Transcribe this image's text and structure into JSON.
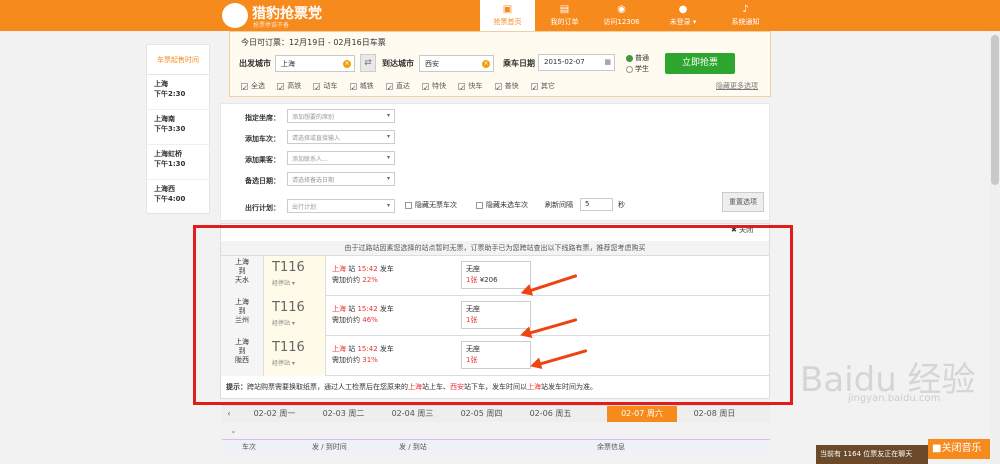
{
  "app": {
    "logo_title": "猎豹抢票党",
    "logo_sub": "抢票停谁不备"
  },
  "nav": [
    {
      "label": "抢票首页",
      "icon": "bus-icon"
    },
    {
      "label": "我的订单",
      "icon": "document-icon"
    },
    {
      "label": "访问12306",
      "icon": "globe-icon"
    },
    {
      "label": "未登录 ▾",
      "icon": "user-icon"
    },
    {
      "label": "系统通知",
      "icon": "bell-icon"
    }
  ],
  "booking": {
    "info": "今日可订票：12月19日 - 02月16日车票",
    "from_label": "出发城市",
    "from_value": "上海",
    "to_label": "到达城市",
    "to_value": "西安",
    "date_label": "乘车日期",
    "date_value": "2015-02-07",
    "radio_normal": "普通",
    "radio_student": "学生",
    "grab_button": "立即抢票",
    "types": [
      "全选",
      "高铁",
      "动车",
      "城铁",
      "直达",
      "特快",
      "快车",
      "普快",
      "其它"
    ],
    "more_options": "隐藏更多选项"
  },
  "sidebar": {
    "header": "车票起售时间",
    "items": [
      {
        "station": "上海",
        "time": "下午2:30"
      },
      {
        "station": "上海南",
        "time": "下午3:30"
      },
      {
        "station": "上海虹桥",
        "time": "下午1:30"
      },
      {
        "station": "上海西",
        "time": "下午4:00"
      }
    ]
  },
  "options": {
    "seat_label": "指定坐席：",
    "seat_ph": "添加想要的席别",
    "train_label": "添加车次：",
    "train_ph": "请选择或直接输入",
    "passenger_label": "添加乘客：",
    "passenger_ph": "添加联系人...",
    "backup_label": "备选日期：",
    "backup_ph": "请选择备选日期",
    "plan_label": "出行计划：",
    "plan_ph": "出行计划",
    "hide_no_ticket": "隐藏无票车次",
    "hide_unselected": "隐藏未选车次",
    "refresh_label": "刷新间隔",
    "refresh_value": "5",
    "refresh_unit": "秒",
    "reset_button": "重置选项"
  },
  "popup": {
    "close_label": "关闭",
    "note": "由于过路站因素您选择的站点暂时无票，订票助手已为您跨站查出以下线路有票，推荐您考虑购买",
    "rows": [
      {
        "from": "上海",
        "to_word": "到",
        "to": "天水",
        "train": "T116",
        "via": "经停站 ▾",
        "dep_station": "上海",
        "station_word": "站",
        "dep_time": "15:42",
        "dep_word": "发车",
        "extra_label": "需加价约",
        "extra_value": "22%",
        "seat_type": "无座",
        "tickets": "1张",
        "price": "¥206"
      },
      {
        "from": "上海",
        "to_word": "到",
        "to": "兰州",
        "train": "T116",
        "via": "经停站 ▾",
        "dep_station": "上海",
        "station_word": "站",
        "dep_time": "15:42",
        "dep_word": "发车",
        "extra_label": "需加价约",
        "extra_value": "46%",
        "seat_type": "无座",
        "tickets": "1张",
        "price": ""
      },
      {
        "from": "上海",
        "to_word": "到",
        "to": "陇西",
        "train": "T116",
        "via": "经停站 ▾",
        "dep_station": "上海",
        "station_word": "站",
        "dep_time": "15:42",
        "dep_word": "发车",
        "extra_label": "需加价约",
        "extra_value": "31%",
        "seat_type": "无座",
        "tickets": "1张",
        "price": ""
      }
    ],
    "tip_label": "提示：",
    "tip_a": "跨站购票需要换取纸票，通过人工检票后在您原来的",
    "tip_b": "上海",
    "tip_c": "站上车、",
    "tip_d": "西安",
    "tip_e": "站下车，发车时间以",
    "tip_f": "上海",
    "tip_g": "站发车时间为准。"
  },
  "dates": [
    {
      "date": "02-02",
      "day": "周一"
    },
    {
      "date": "02-03",
      "day": "周二"
    },
    {
      "date": "02-04",
      "day": "周三"
    },
    {
      "date": "02-05",
      "day": "周四"
    },
    {
      "date": "02-06",
      "day": "周五"
    },
    {
      "date": "02-07",
      "day": "周六"
    },
    {
      "date": "02-08",
      "day": "周日"
    }
  ],
  "table_headers": [
    "车次",
    "发 / 到时间",
    "发 / 到站",
    "余票信息"
  ],
  "watermark": "Baidu 经验",
  "watermark_sub": "jingyan.baidu.com",
  "queue_text": "当前有 1164 位票友正在聊天",
  "music_button": "■关闭音乐",
  "colors": {
    "brand": "#f78a1d",
    "accent_red": "#e33",
    "highlight_box": "#e31b1b",
    "go_button": "#2ea52e"
  }
}
